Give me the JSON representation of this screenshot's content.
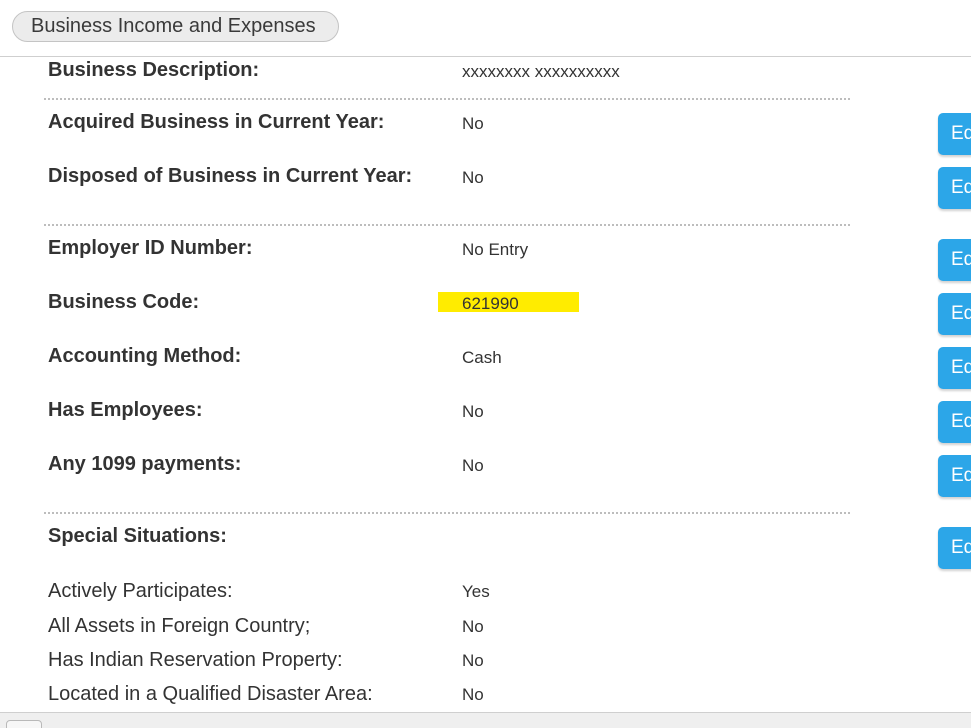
{
  "header": {
    "title": "Business Income and Expenses"
  },
  "rows": {
    "business_description": {
      "label": "Business Description:",
      "value": "xxxxxxxx xxxxxxxxxx"
    },
    "acquired": {
      "label": "Acquired Business in Current Year:",
      "value": "No"
    },
    "disposed": {
      "label": "Disposed of Business in Current Year:",
      "value": "No"
    },
    "employer_id": {
      "label": "Employer ID Number:",
      "value": "No Entry"
    },
    "business_code": {
      "label": "Business Code:",
      "value": "621990"
    },
    "accounting_method": {
      "label": "Accounting Method:",
      "value": "Cash"
    },
    "has_employees": {
      "label": "Has Employees:",
      "value": "No"
    },
    "any_1099": {
      "label": "Any 1099 payments:",
      "value": "No"
    },
    "special_situations": {
      "label": "Special Situations:"
    },
    "actively_participates": {
      "label": "Actively Participates:",
      "value": "Yes"
    },
    "foreign_assets": {
      "label": "All Assets in Foreign Country;",
      "value": "No"
    },
    "indian_reservation": {
      "label": "Has Indian Reservation Property:",
      "value": "No"
    },
    "disaster_area": {
      "label": "Located in a Qualified Disaster Area:",
      "value": "No"
    }
  },
  "edit_button": {
    "label": "Ed"
  },
  "colors": {
    "highlight": "#ffec00",
    "edit_button": "#2ca6e8"
  }
}
